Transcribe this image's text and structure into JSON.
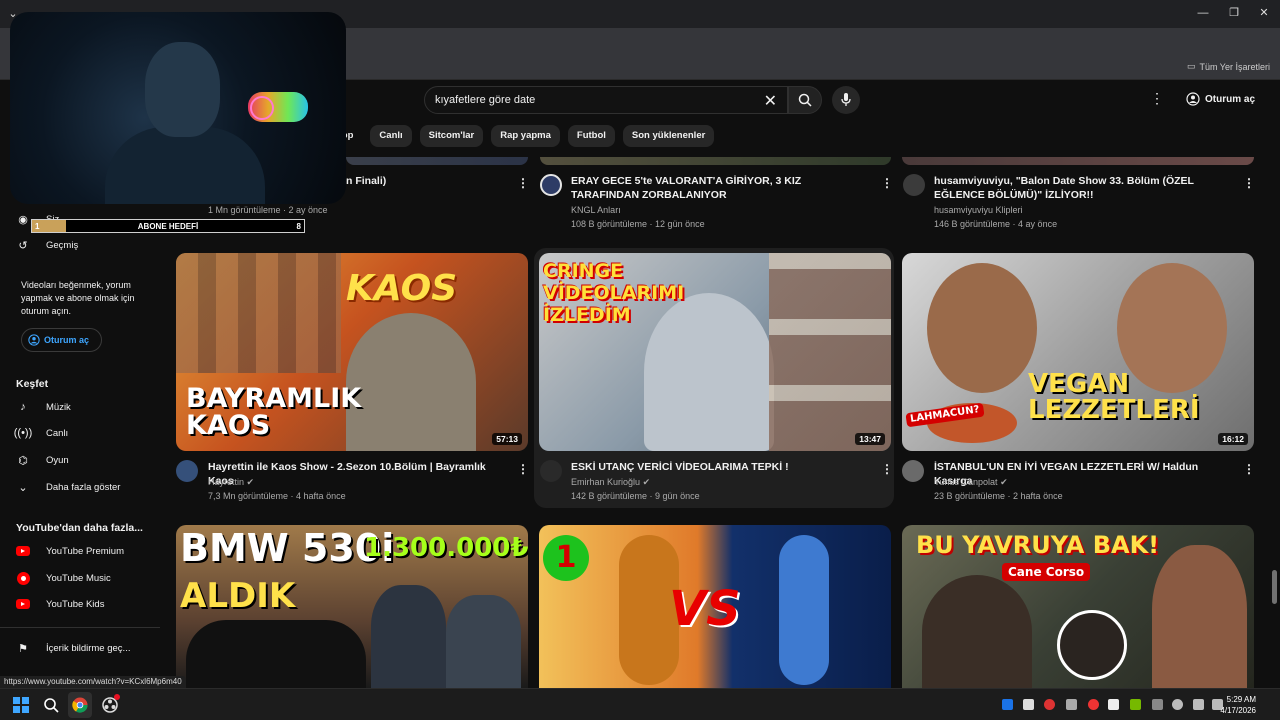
{
  "browser": {
    "bookmarks_label": "Tüm Yer İşaretleri",
    "status_url": "https://www.youtube.com/watch?v=KCxl6Mp6m40"
  },
  "overlay": {
    "goal_label": "ABONE HEDEFİ",
    "goal_current": "1",
    "goal_target": "8",
    "goal_progress": 0.125
  },
  "header": {
    "search_value": "kıyafetlere göre date",
    "signin_label": "Oturum aç"
  },
  "chips": [
    "hop",
    "Canlı",
    "Sitcom'lar",
    "Rap yapma",
    "Futbol",
    "Son yüklenenler"
  ],
  "sidebar": {
    "you_label": "Siz",
    "history_label": "Geçmiş",
    "note": "Videoları beğenmek, yorum yapmak ve abone olmak için oturum açın.",
    "signin_label": "Oturum aç",
    "explore_title": "Keşfet",
    "explore_items": [
      "Müzik",
      "Canlı",
      "Oyun",
      "Daha fazla göster"
    ],
    "more_title": "YouTube'dan daha fazla...",
    "more_items": [
      "YouTube Premium",
      "YouTube Music",
      "YouTube Kids"
    ],
    "report_label": "İçerik bildirme geç..."
  },
  "row1": [
    {
      "title": "n Finali)",
      "channel": "",
      "stats": "1 Mn görüntüleme · 2 ay önce"
    },
    {
      "title": "ERAY GECE 5'te VALORANT'A GİRİYOR, 3 KIZ TARAFINDAN ZORBALANIYOR",
      "channel": "KNGL Anları",
      "stats": "108 B görüntüleme · 12 gün önce"
    },
    {
      "title": "husamviyuviyu, \"Balon Date Show 33. Bölüm (ÖZEL EĞLENCE BÖLÜMÜ)\" İZLİYOR!!",
      "channel": "husamviyuviyu Klipleri",
      "stats": "146 B görüntüleme · 4 ay önce"
    }
  ],
  "row2": [
    {
      "title": "Hayrettin ile Kaos Show - 2.Sezon 10.Bölüm | Bayramlık Kaos",
      "channel": "Hayrettin",
      "stats": "7,3 Mn görüntüleme · 4 hafta önce",
      "duration": "57:13",
      "thumb_text": "BAYRAMLIK KAOS",
      "thumb_logo": "KAOS"
    },
    {
      "title": "ESKİ UTANÇ VERİCİ VİDEOLARIMA TEPKİ !",
      "channel": "Emirhan Kurioğlu",
      "stats": "142 B görüntüleme · 9 gün önce",
      "duration": "13:47",
      "thumb_text": "CRINGE VİDEOLARIMI İZLEDİM"
    },
    {
      "title": "İSTANBUL'UN EN İYİ VEGAN LEZZETLERİ W/ Haldun Kasırga",
      "channel": "Yunus Canpolat",
      "stats": "23 B görüntüleme · 2 hafta önce",
      "duration": "16:12",
      "thumb_text": "VEGAN LEZZETLERİ",
      "thumb_sub": "LAHMACUN?"
    }
  ],
  "row3": [
    {
      "thumb_text": "BMW 530i",
      "thumb_sub": "ALDIK",
      "thumb_price": "1.300.000₺"
    },
    {
      "thumb_text": "VS",
      "thumb_badge": "1"
    },
    {
      "thumb_text": "BU YAVRUYA BAK!",
      "thumb_sub": "Cane Corso"
    }
  ],
  "taskbar": {
    "time": "5:29 AM",
    "date": "4/17/2026"
  },
  "colors": {
    "bg": "#0f0f0f",
    "accent_link": "#3ea6ff",
    "yt_red": "#ff0000"
  }
}
